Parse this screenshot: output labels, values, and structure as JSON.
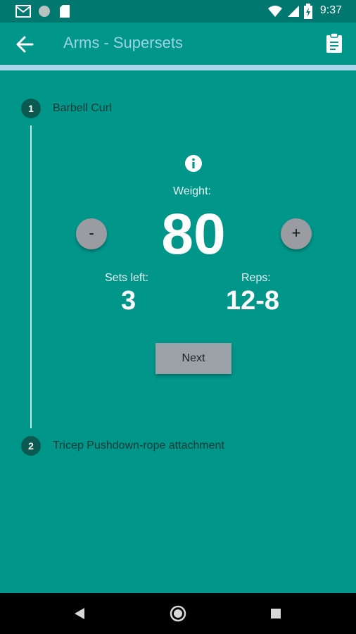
{
  "status_bar": {
    "time": "9:37",
    "icons": [
      "gmail-icon",
      "circle-icon",
      "sd-card-icon",
      "wifi-icon",
      "signal-icon",
      "battery-icon"
    ]
  },
  "app_bar": {
    "title": "Arms - Supersets",
    "back_icon": "arrow-back-icon",
    "action_icon": "clipboard-icon"
  },
  "steps": [
    {
      "number": "1",
      "label": "Barbell Curl"
    },
    {
      "number": "2",
      "label": "Tricep Pushdown-rope attachment"
    }
  ],
  "exercise": {
    "weight_label": "Weight:",
    "weight_value": "80",
    "decrement_label": "-",
    "increment_label": "+",
    "sets_label": "Sets left:",
    "sets_value": "3",
    "reps_label": "Reps:",
    "reps_value": "12-8",
    "next_label": "Next"
  },
  "colors": {
    "primary": "#00968a",
    "status_bar": "#00786f",
    "accent": "#a9d8ea",
    "step_circle": "#0b5a51"
  }
}
